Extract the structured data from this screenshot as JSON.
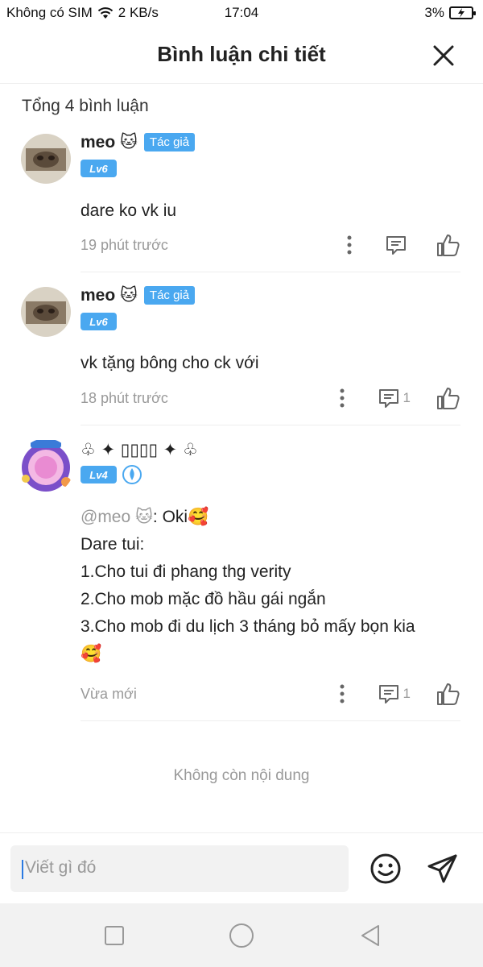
{
  "status": {
    "carrier": "Không có SIM",
    "speed": "2 KB/s",
    "time": "17:04",
    "battery": "3%"
  },
  "header": {
    "title": "Bình luận chi tiết"
  },
  "total": "Tổng 4 bình luận",
  "comments": [
    {
      "name": "meo 🐱",
      "tag": "Tác giả",
      "level": "Lv6",
      "text": "dare ko vk iu",
      "time": "19 phút trước",
      "reply_count": ""
    },
    {
      "name": "meo 🐱",
      "tag": "Tác giả",
      "level": "Lv6",
      "text": "vk tặng bông cho ck với",
      "time": "18 phút trước",
      "reply_count": "1"
    },
    {
      "name": "♧ ✦ ▯▯▯▯ ✦ ♧",
      "level": "Lv4",
      "mention": "@meo 🐱",
      "mention_suffix": ": Oki🥰",
      "lines": [
        "Dare tui:",
        "1.Cho tui đi phang thg verity",
        "2.Cho mob mặc đồ hầu gái ngắn",
        "3.Cho mob đi du lịch 3 tháng bỏ mấy bọn kia",
        "🥰"
      ],
      "time": "Vừa mới",
      "reply_count": "1"
    }
  ],
  "no_more": "Không còn nội dung",
  "composer": {
    "placeholder": "Viết gì đó"
  },
  "colors": {
    "accent": "#4aa8f0",
    "muted": "#999999"
  }
}
